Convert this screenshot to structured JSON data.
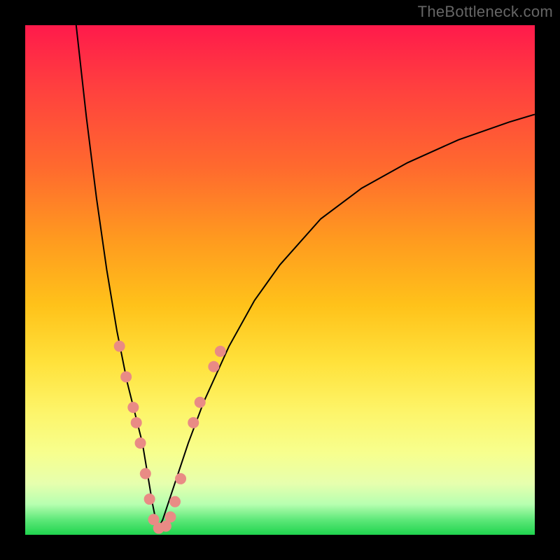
{
  "watermark": "TheBottleneck.com",
  "chart_data": {
    "type": "line",
    "title": "",
    "xlabel": "",
    "ylabel": "",
    "xlim": [
      0,
      100
    ],
    "ylim": [
      0,
      100
    ],
    "grid": false,
    "legend": false,
    "series": [
      {
        "name": "curve-left",
        "x": [
          10,
          12,
          14,
          16,
          18,
          20,
          21,
          22,
          23,
          24,
          25,
          26
        ],
        "y": [
          100,
          82,
          66,
          52,
          40,
          30,
          26,
          22,
          18,
          12,
          6,
          1
        ],
        "color": "#000000"
      },
      {
        "name": "curve-right",
        "x": [
          26,
          27,
          28,
          30,
          32,
          35,
          40,
          45,
          50,
          58,
          66,
          75,
          85,
          95,
          100
        ],
        "y": [
          1,
          3,
          6,
          12,
          18,
          26,
          37,
          46,
          53,
          62,
          68,
          73,
          77.5,
          81,
          82.5
        ],
        "color": "#000000"
      }
    ],
    "markers": [
      {
        "name": "pink-dots",
        "color": "#e98b85",
        "radius_px": 8,
        "points": [
          {
            "x": 18.5,
            "y": 37
          },
          {
            "x": 19.8,
            "y": 31
          },
          {
            "x": 21.2,
            "y": 25
          },
          {
            "x": 21.8,
            "y": 22
          },
          {
            "x": 22.6,
            "y": 18
          },
          {
            "x": 23.6,
            "y": 12
          },
          {
            "x": 24.4,
            "y": 7
          },
          {
            "x": 25.2,
            "y": 3
          },
          {
            "x": 26.2,
            "y": 1.3
          },
          {
            "x": 27.6,
            "y": 1.7
          },
          {
            "x": 28.5,
            "y": 3.5
          },
          {
            "x": 29.4,
            "y": 6.5
          },
          {
            "x": 30.5,
            "y": 11
          },
          {
            "x": 33.0,
            "y": 22
          },
          {
            "x": 34.3,
            "y": 26
          },
          {
            "x": 37.0,
            "y": 33
          },
          {
            "x": 38.3,
            "y": 36
          }
        ]
      }
    ]
  }
}
